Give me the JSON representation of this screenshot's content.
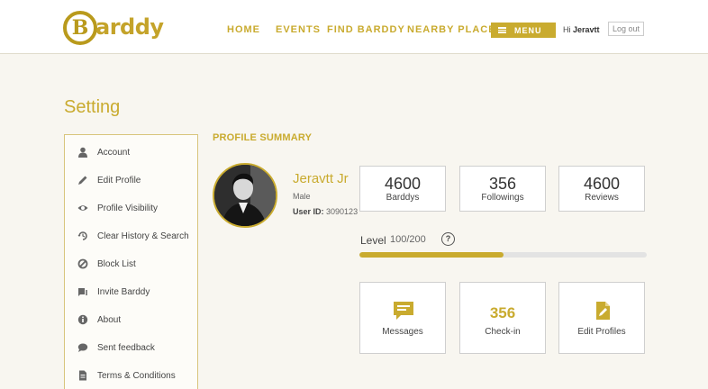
{
  "header": {
    "logo_letter": "B",
    "logo_text": "arddy",
    "nav": {
      "home": "HOME",
      "events": "EVENTS",
      "find": "FIND BARDDY",
      "nearby": "NEARBY PLACES"
    },
    "menu_label": "MENU",
    "greeting_prefix": "Hi",
    "user_name": "Jeravtt",
    "logout": "Log out",
    "accent_color": "#c9ab2f"
  },
  "page_title": "Setting",
  "sidebar": {
    "items": [
      {
        "label": "Account",
        "icon": "user-icon"
      },
      {
        "label": "Edit Profile",
        "icon": "pencil-icon"
      },
      {
        "label": "Profile Visibility",
        "icon": "eye-icon"
      },
      {
        "label": "Clear History & Search",
        "icon": "history-icon"
      },
      {
        "label": "Block List",
        "icon": "block-icon"
      },
      {
        "label": "Invite Barddy",
        "icon": "invite-icon"
      },
      {
        "label": "About",
        "icon": "info-icon"
      },
      {
        "label": "Sent feedback",
        "icon": "chat-icon"
      },
      {
        "label": "Terms & Conditions",
        "icon": "document-icon"
      }
    ]
  },
  "summary": {
    "title": "PROFILE SUMMARY",
    "name": "Jeravtt Jr",
    "gender": "Male",
    "user_id_label": "User ID:",
    "user_id": "3090123",
    "stats": [
      {
        "value": "4600",
        "label": "Barddys"
      },
      {
        "value": "356",
        "label": "Followings"
      },
      {
        "value": "4600",
        "label": "Reviews"
      }
    ],
    "level_label": "Level",
    "level_value": "100/200",
    "level_progress": 0.5,
    "help": "?",
    "actions": [
      {
        "label": "Messages",
        "icon": "message-icon"
      },
      {
        "value": "356",
        "label": "Check-in"
      },
      {
        "label": "Edit Profiles",
        "icon": "edit-document-icon"
      }
    ]
  }
}
